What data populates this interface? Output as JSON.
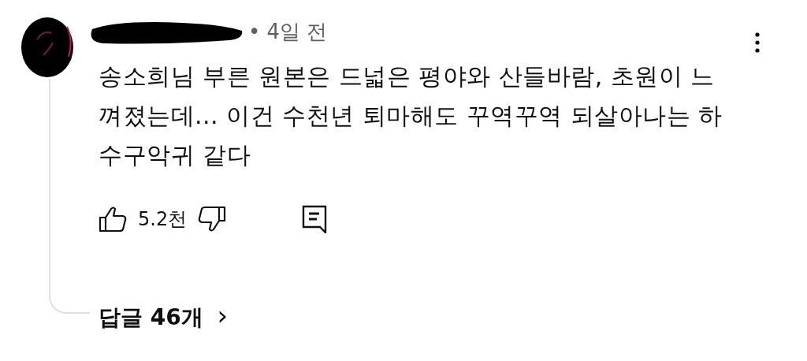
{
  "comment": {
    "time": "• 4일 전",
    "text": "송소희님 부른 원본은 드넓은 평야와 산들바람, 초원이 느껴졌는데... 이건 수천년 퇴마해도 꾸역꾸역 되살아나는 하수구악귀 같다",
    "likes": "5.2천",
    "replies": "답글 46개",
    "replies_arrow": "›"
  }
}
